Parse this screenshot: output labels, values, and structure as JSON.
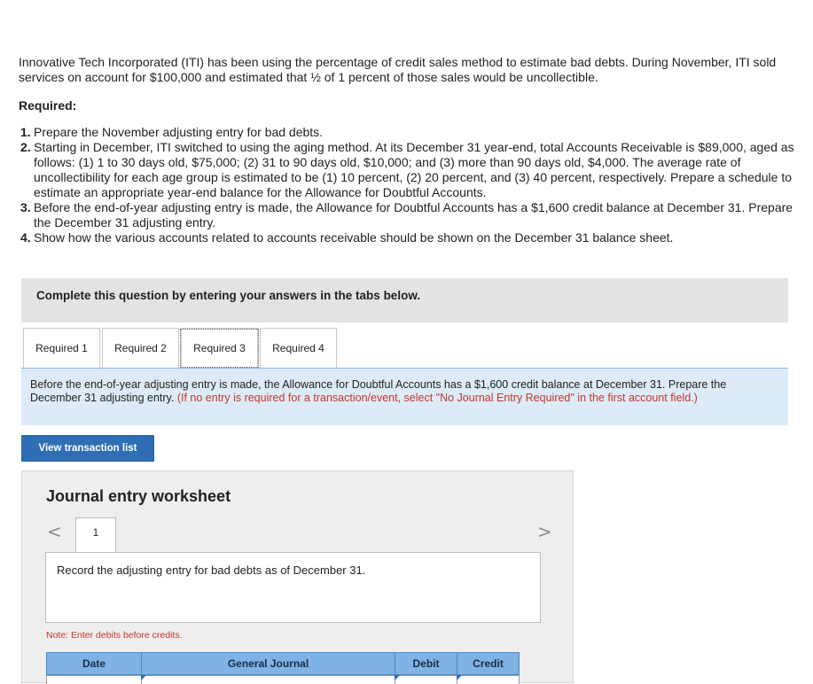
{
  "problem": {
    "intro": "Innovative Tech Incorporated (ITI) has been using the percentage of credit sales method to estimate bad debts. During November, ITI sold services on account for $100,000 and estimated that ½ of 1 percent of those sales would be uncollectible.",
    "required_label": "Required:",
    "items": [
      {
        "num": "1.",
        "text": "Prepare the November adjusting entry for bad debts."
      },
      {
        "num": "2.",
        "text": "Starting in December, ITI switched to using the aging method. At its December 31 year-end, total Accounts Receivable is $89,000, aged as follows: (1) 1 to 30 days old, $75,000; (2) 31 to 90 days old, $10,000; and (3) more than 90 days old, $4,000. The average rate of uncollectibility for each age group is estimated to be (1) 10 percent, (2) 20 percent, and (3) 40 percent, respectively. Prepare a schedule to estimate an appropriate year-end balance for the Allowance for Doubtful Accounts."
      },
      {
        "num": "3.",
        "text": "Before the end-of-year adjusting entry is made, the Allowance for Doubtful Accounts has a $1,600 credit balance at December 31. Prepare the December 31 adjusting entry."
      },
      {
        "num": "4.",
        "text": "Show how the various accounts related to accounts receivable should be shown on the December 31 balance sheet."
      }
    ]
  },
  "complete_box": {
    "text": "Complete this question by entering your answers in the tabs below."
  },
  "tabs": [
    {
      "label": "Required 1",
      "active": false
    },
    {
      "label": "Required 2",
      "active": false
    },
    {
      "label": "Required 3",
      "active": true
    },
    {
      "label": "Required 4",
      "active": false
    }
  ],
  "instructions": {
    "text": "Before the end-of-year adjusting entry is made, the Allowance for Doubtful Accounts has a $1,600 credit balance at December 31. Prepare the December 31 adjusting entry.",
    "red_note": "(If no entry is required for a transaction/event, select \"No Journal Entry Required\" in the first account field.)"
  },
  "view_button": {
    "label": "View transaction list"
  },
  "worksheet": {
    "title": "Journal entry worksheet",
    "entry_number": "1",
    "prev_arrow": "<",
    "next_arrow": ">",
    "entry_description": "Record the adjusting entry for bad debts as of December 31.",
    "note": "Note: Enter debits before credits.",
    "columns": [
      "Date",
      "General Journal",
      "Debit",
      "Credit"
    ]
  },
  "colors": {
    "accent_blue": "#2f6eb5",
    "header_blue": "#7fb2e5",
    "instruction_bg": "#dcebf7",
    "note_red": "#c0392b"
  }
}
